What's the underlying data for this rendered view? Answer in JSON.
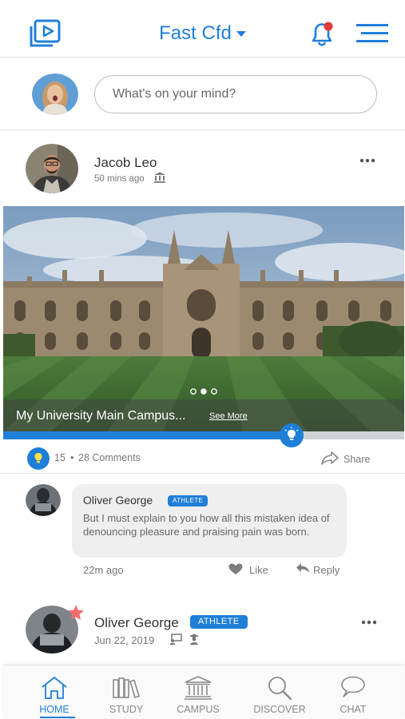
{
  "header": {
    "brand": "Fast Cfd",
    "notification_dot_color": "#e53935",
    "accent_color": "#1f7fd8"
  },
  "composer": {
    "placeholder": "What's on your mind?"
  },
  "post": {
    "author": "Jacob Leo",
    "time": "50 mins ago",
    "caption": "My University Main Campus...",
    "see_more": "See More",
    "carousel": {
      "count": 3,
      "active_index": 1
    },
    "progress_fraction": 0.72,
    "like_count": "15",
    "separator": "•",
    "comments": "28 Comments",
    "share_label": "Share"
  },
  "comment": {
    "author": "Oliver George",
    "badge": "ATHLETE",
    "text": "But I must explain to you how all this mistaken idea of denouncing pleasure and praising pain was born.",
    "time": "22m ago",
    "like_label": "Like",
    "reply_label": "Reply"
  },
  "second_post": {
    "author": "Oliver George",
    "badge": "ATHLETE",
    "date": "Jun 22, 2019",
    "star_color": "#f26b6b"
  },
  "nav": {
    "items": [
      {
        "label": "HOME",
        "icon": "home-icon",
        "active": true
      },
      {
        "label": "STUDY",
        "icon": "books-icon",
        "active": false
      },
      {
        "label": "CAMPUS",
        "icon": "campus-icon",
        "active": false
      },
      {
        "label": "DISCOVER",
        "icon": "search-icon",
        "active": false
      },
      {
        "label": "CHAT",
        "icon": "chat-icon",
        "active": false
      }
    ]
  }
}
